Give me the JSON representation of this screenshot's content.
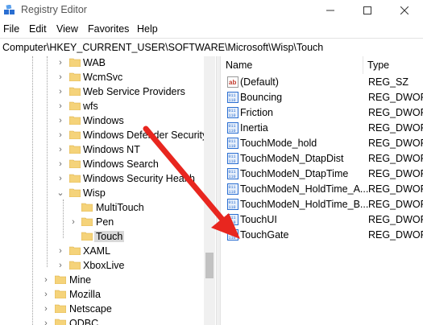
{
  "window": {
    "title": "Registry Editor"
  },
  "menu": [
    "File",
    "Edit",
    "View",
    "Favorites",
    "Help"
  ],
  "address": "Computer\\HKEY_CURRENT_USER\\SOFTWARE\\Microsoft\\Wisp\\Touch",
  "tree": {
    "items": [
      {
        "label": "WAB",
        "depth": 0,
        "expander": "collapsed"
      },
      {
        "label": "WcmSvc",
        "depth": 0,
        "expander": "collapsed"
      },
      {
        "label": "Web Service Providers",
        "depth": 0,
        "expander": "collapsed"
      },
      {
        "label": "wfs",
        "depth": 0,
        "expander": "collapsed"
      },
      {
        "label": "Windows",
        "depth": 0,
        "expander": "collapsed"
      },
      {
        "label": "Windows Defender Security",
        "depth": 0,
        "expander": "collapsed"
      },
      {
        "label": "Windows NT",
        "depth": 0,
        "expander": "collapsed"
      },
      {
        "label": "Windows Search",
        "depth": 0,
        "expander": "collapsed"
      },
      {
        "label": "Windows Security Health",
        "depth": 0,
        "expander": "collapsed"
      },
      {
        "label": "Wisp",
        "depth": 0,
        "expander": "expanded"
      },
      {
        "label": "MultiTouch",
        "depth": 1,
        "expander": "none"
      },
      {
        "label": "Pen",
        "depth": 1,
        "expander": "collapsed"
      },
      {
        "label": "Touch",
        "depth": 1,
        "expander": "none",
        "selected": true
      },
      {
        "label": "XAML",
        "depth": 0,
        "expander": "collapsed"
      },
      {
        "label": "XboxLive",
        "depth": 0,
        "expander": "collapsed"
      },
      {
        "label": "Mine",
        "depth": -1,
        "expander": "collapsed"
      },
      {
        "label": "Mozilla",
        "depth": -1,
        "expander": "collapsed"
      },
      {
        "label": "Netscape",
        "depth": -1,
        "expander": "collapsed"
      },
      {
        "label": "ODBC",
        "depth": -1,
        "expander": "collapsed"
      }
    ]
  },
  "list": {
    "headers": {
      "name": "Name",
      "type": "Type"
    },
    "rows": [
      {
        "name": "(Default)",
        "type": "REG_SZ",
        "icon": "string-value-icon"
      },
      {
        "name": "Bouncing",
        "type": "REG_DWORD",
        "icon": "dword-value-icon"
      },
      {
        "name": "Friction",
        "type": "REG_DWORD",
        "icon": "dword-value-icon"
      },
      {
        "name": "Inertia",
        "type": "REG_DWORD",
        "icon": "dword-value-icon"
      },
      {
        "name": "TouchMode_hold",
        "type": "REG_DWORD",
        "icon": "dword-value-icon"
      },
      {
        "name": "TouchModeN_DtapDist",
        "type": "REG_DWORD",
        "icon": "dword-value-icon"
      },
      {
        "name": "TouchModeN_DtapTime",
        "type": "REG_DWORD",
        "icon": "dword-value-icon"
      },
      {
        "name": "TouchModeN_HoldTime_A...",
        "type": "REG_DWORD",
        "icon": "dword-value-icon"
      },
      {
        "name": "TouchModeN_HoldTime_B...",
        "type": "REG_DWORD",
        "icon": "dword-value-icon"
      },
      {
        "name": "TouchUI",
        "type": "REG_DWORD",
        "icon": "dword-value-icon"
      },
      {
        "name": "TouchGate",
        "type": "REG_DWORD",
        "icon": "dword-value-icon",
        "highlighted": true
      }
    ]
  },
  "colors": {
    "folder": "#f5d37a",
    "folder_edge": "#d9ab3f",
    "arrow": "#e8261f",
    "dword_icon": "#2a6ed1",
    "string_icon": "#c0392b"
  }
}
